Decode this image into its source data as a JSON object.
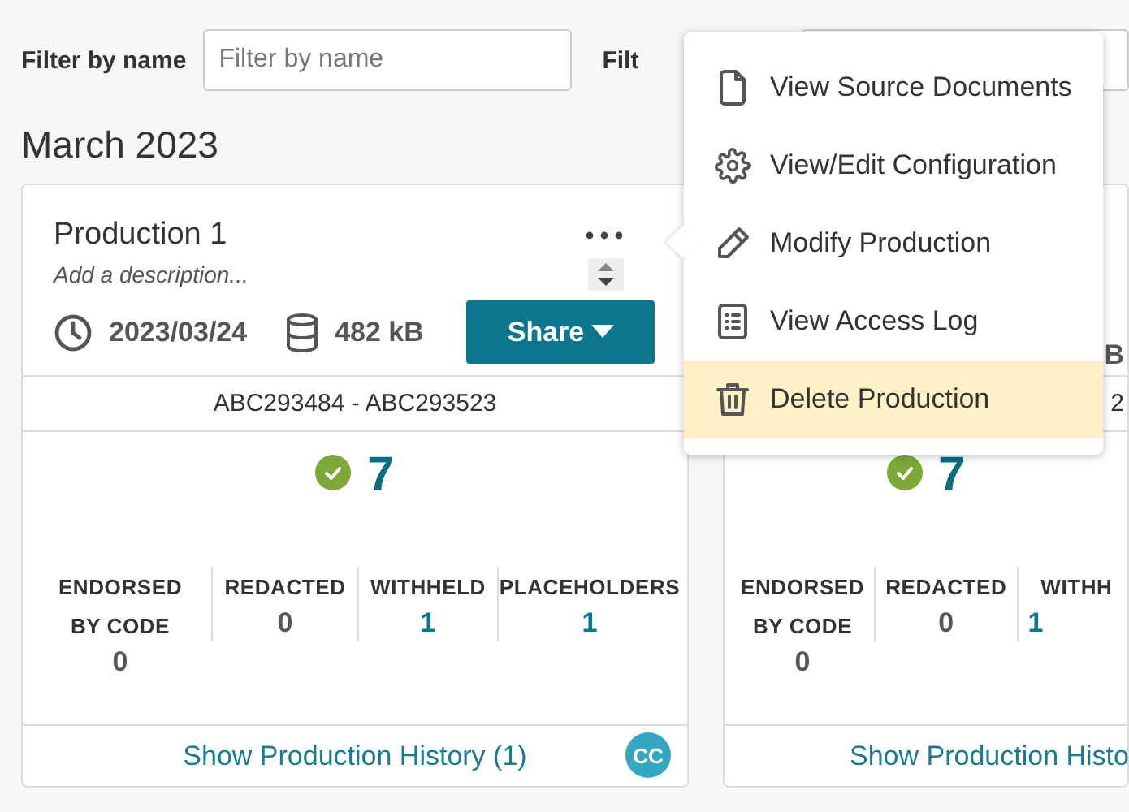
{
  "filters": [
    {
      "label": "Filter by name",
      "placeholder": "Filter by name"
    },
    {
      "label": "Filt"
    }
  ],
  "month": "March 2023",
  "cards": [
    {
      "title": "Production 1",
      "description_placeholder": "Add a description...",
      "date": "2023/03/24",
      "size": "482 kB",
      "share": "Share",
      "range": "ABC293484 - ABC293523",
      "total": "7",
      "complete": true,
      "stats": [
        {
          "label": "ENDORSED BY CODE",
          "value": "0",
          "linked": false
        },
        {
          "label": "REDACTED",
          "value": "0",
          "linked": false
        },
        {
          "label": "WITHHELD",
          "value": "1",
          "linked": true
        },
        {
          "label": "PLACEHOLDERS",
          "value": "1",
          "linked": true
        }
      ],
      "history": "Show Production History (1)",
      "avatar": "CC"
    },
    {
      "size": "B",
      "range": "2",
      "total": "7",
      "complete": true,
      "stats": [
        {
          "label": "ENDORSED BY CODE",
          "value": "0",
          "linked": false
        },
        {
          "label": "REDACTED",
          "value": "0",
          "linked": false
        },
        {
          "label": "WITHH",
          "value": "1",
          "linked": true
        }
      ],
      "history": "Show Production Histo"
    }
  ],
  "menu": [
    {
      "label": "View Source Documents",
      "selected": false
    },
    {
      "label": "View/Edit Configuration",
      "selected": false
    },
    {
      "label": "Modify Production",
      "selected": false
    },
    {
      "label": "View Access Log",
      "selected": false
    },
    {
      "label": "Delete Production",
      "selected": true
    }
  ]
}
